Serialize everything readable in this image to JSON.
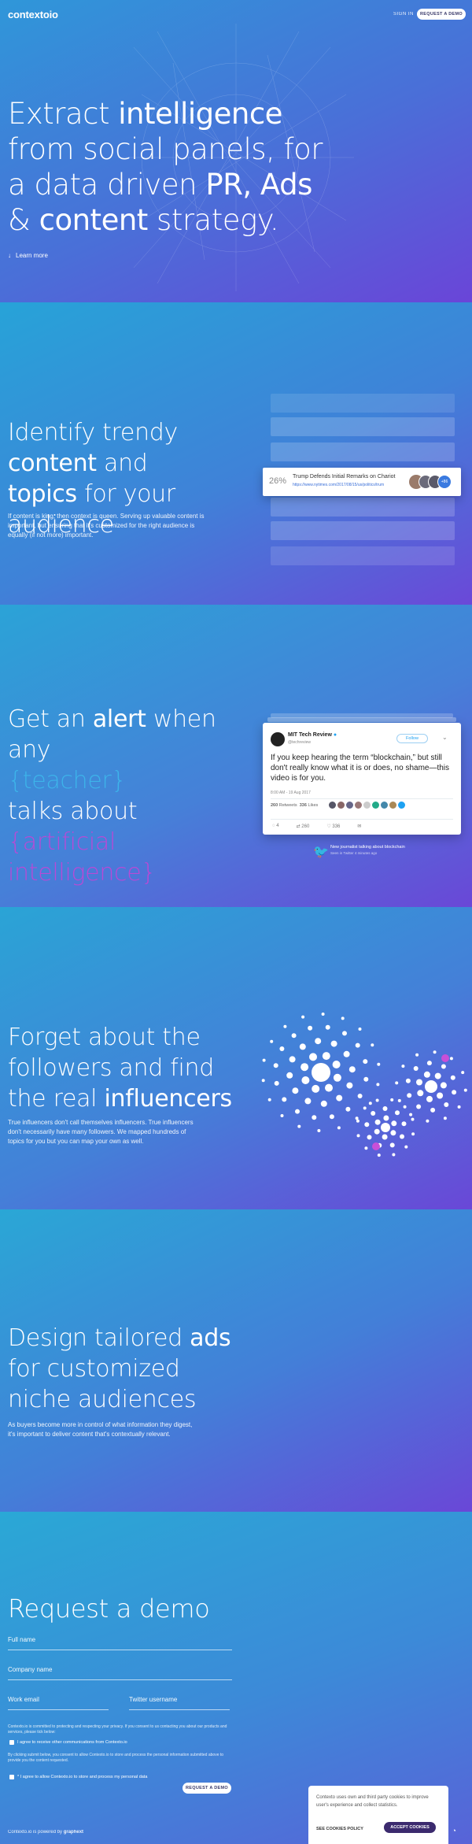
{
  "header": {
    "logo": "contextoio",
    "signin": "SIGN IN",
    "demo_btn": "REQUEST A DEMO"
  },
  "hero": {
    "title_parts": [
      "Extract ",
      "intelligence",
      " from social panels, for a data driven ",
      "PR, Ads",
      " & ",
      "content",
      " strategy."
    ],
    "learn_more": "Learn more",
    "arrow_icon": "arrow-down-icon"
  },
  "trends": {
    "title_parts": [
      "Identify trendy ",
      "content",
      " and ",
      "topics",
      " for your audience"
    ],
    "body": "If content is king, then context is queen. Serving up valuable content is important, but ensuring that it's customized for the right audience is equally (if not more) important.",
    "card": {
      "percent": "26%",
      "headline": "Trump Defends Initial Remarks on Chariot",
      "url": "https://www.nytimes.com/2017/08/15/us/politics/trum"
    }
  },
  "alert": {
    "title_parts": [
      "Get an ",
      "alert",
      " when any ",
      "{teacher}",
      " talks about ",
      "{artificial intelligence}"
    ],
    "tweet": {
      "name": "MIT Tech Review",
      "handle": "@techreview",
      "follow": "Follow",
      "text": "If you keep hearing the term “blockchain,” but still don't really know what it is or does, no shame—this video is for you.",
      "time": "8:00 AM - 19 Aug 2017",
      "retweets_num": "260",
      "retweets_label": "Retweets",
      "likes_num": "336",
      "likes_label": "Likes",
      "reply_count": "4",
      "retweet_count": "260",
      "like_count": "336"
    },
    "notif_title": "New journalist talking about blockchain",
    "notif_sub": "Seen in Twitter 4 minutes ago"
  },
  "influencers": {
    "title_parts": [
      "Forget about the followers and find the real ",
      "influencers"
    ],
    "body": "True influencers don't call themselves influencers. True influencers don't necessarily have many followers. We mapped hundreds of topics for you but you can map your own as well."
  },
  "ads": {
    "title_parts": [
      "Design tailored ",
      "ads",
      " for customized niche audiences"
    ],
    "body": "As buyers become more in control of what information they digest, it's important to deliver content that's contextually relevant."
  },
  "demo": {
    "title": "Request a demo",
    "full_name": "Full name",
    "company": "Company name",
    "email": "Work email",
    "twitter": "Twitter username",
    "privacy_text": "Contexto.io is committed to protecting and respecting your privacy. If you consent to us contacting you about our products and services, please tick below:",
    "consent1": "I agree to receive other communications from Contexto.io",
    "submit_text": "By clicking submit below, you consent to allow Contexto.io to store and process the personal information submitted above to provide you the content requested.",
    "consent2": "* I agree to allow Contexto.io to store and process my personal data",
    "submit_btn": "REQUEST A DEMO"
  },
  "cookie": {
    "text": "Contexto uses own and third party cookies to improve user's experience and collect statistics.",
    "policy": "SEE COOKIES POLICY",
    "accept": "ACCEPT COOKIES"
  },
  "footer": {
    "text": "Contexto.io is powered by ",
    "brand": "graphext"
  },
  "colors": {
    "accent_teal": "#3db4ea",
    "accent_pink": "#b84ad6",
    "button_dark": "#3b2a6e"
  }
}
